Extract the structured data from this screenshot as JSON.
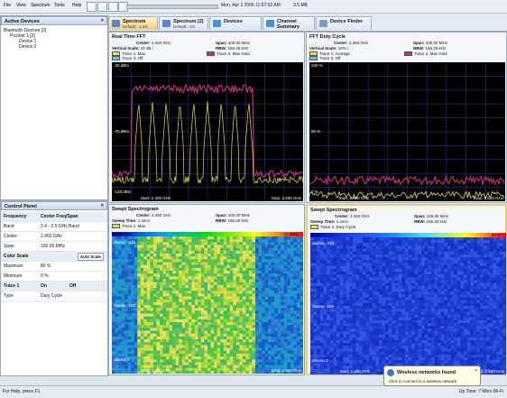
{
  "menu": {
    "items": [
      "File",
      "View",
      "Spectrum",
      "Tools",
      "Help"
    ],
    "datetime": "Mon, Apr 3 2006 11:57:02 AM",
    "zoom": "3.5 MB"
  },
  "devices_pane": {
    "title": "Active Devices",
    "root": "Bluetooth Devices [2]",
    "group": "Piconet 1 [2]",
    "children": [
      "Device 1",
      "Device 2"
    ]
  },
  "control_panel": {
    "title": "Control Panel",
    "rows": [
      {
        "k": "Frequency",
        "v": "Center Freq/Span",
        "bold": true
      },
      {
        "k": "Band",
        "v": "2.4 - 2.5 GHz Band"
      },
      {
        "k": "Center",
        "v": "2.450 GHz"
      },
      {
        "k": "Span",
        "v": "100.00 MHz"
      },
      {
        "k": "Color Scale",
        "v": "",
        "bold": true,
        "button": "Auto Scale"
      },
      {
        "k": "Maximum",
        "v": "80 %"
      },
      {
        "k": "Minimum",
        "v": "0 %"
      },
      {
        "k": "Trace 1",
        "v": "On",
        "bold": true,
        "v2": "Off"
      },
      {
        "k": "Type",
        "v": "Duty Cycle"
      }
    ]
  },
  "tabs": [
    {
      "label": "Spectrum",
      "sub": "Default - 2.4G",
      "color": "#5a86c8"
    },
    {
      "label": "Spectrum (2)",
      "sub": "Default - 5G",
      "color": "#5a86c8"
    },
    {
      "label": "Devices",
      "sub": "",
      "color": "#3e96d8"
    },
    {
      "label": "Channel Summary",
      "sub": "",
      "color": "#3e96d8"
    },
    {
      "label": "Device Finder",
      "sub": "",
      "color": "#7c9ac4"
    }
  ],
  "panels": {
    "fft": {
      "title": "Real Time FFT",
      "center": "2.450 GHz",
      "span": "100.00 MHz",
      "vscale": "10 dB /",
      "rbw": "156.25 kHz",
      "trace1": "Trace 1: Max",
      "trace2": "Trace 2: Max Hold",
      "trace3": "Trace 3: Off",
      "ytop": "-20 dBm",
      "ymid": "-70 dBm",
      "ybot": "-120 dBm",
      "xstart": "Start: 2.400 GHz",
      "xstop": "Stop: 2.500 GHz"
    },
    "duty": {
      "title": "FFT Duty Cycle",
      "center": "2.450 GHz",
      "span": "100.00 MHz",
      "vscale": "10% /",
      "rbw": "156.25 kHz",
      "trace1": "Trace 1: Average",
      "trace2": "Trace 2: Max Hold",
      "trace3": "Trace 3: Off",
      "ytop": "100 %",
      "ymid": "50 %",
      "ybot": "0 %",
      "xstart": "Start: 2.400 GHz",
      "xstop": "Stop: 2.500 GHz"
    },
    "swept1": {
      "title": "Swept Spectrogram",
      "center": "2.450 GHz",
      "span": "100.00 MHz",
      "sweeptime": "1 secs",
      "rbw": "156.25 kHz",
      "trace1": "Trace 1: Max",
      "scale_lo": "-170 dBm",
      "scale_hi": "-42 dBm",
      "ytop": "Sweep -313",
      "ymid": "Sweep -156",
      "ybot": "Sweep 0",
      "xstart": "Start: 2.400 GHz",
      "xstop": "Stop: 2.500 GHz"
    },
    "swept2": {
      "title": "Swept Spectrogram",
      "center": "2.450 GHz",
      "span": "100.00 MHz",
      "sweeptime": "1 secs",
      "rbw": "156.25 kHz",
      "trace1": "Trace 1: Duty Cycle",
      "scale_lo": "0 %",
      "scale_hi": "80 %",
      "ytop": "Sweep -313",
      "ymid": "Sweep -156",
      "ybot": "Sweep 0",
      "xstart": "Start: 2.400 GHz",
      "xstop": "Stop: 2.500 GHz"
    }
  },
  "labels": {
    "center": "Center:",
    "span": "Span:",
    "vscale": "Vertical Scale:",
    "rbw": "RBW:",
    "sweeptime": "Sweep Time:"
  },
  "status": {
    "left": "For Help, press F1",
    "right": "Up Time: 7 Mins  Wi-Fi"
  },
  "toast": {
    "title": "Wireless networks found",
    "body": "Click to connect to a wireless network."
  },
  "colors": {
    "trace_yellow": "#e8e04a",
    "trace_magenta": "#c0307a",
    "grid": "#3a3aa0"
  }
}
